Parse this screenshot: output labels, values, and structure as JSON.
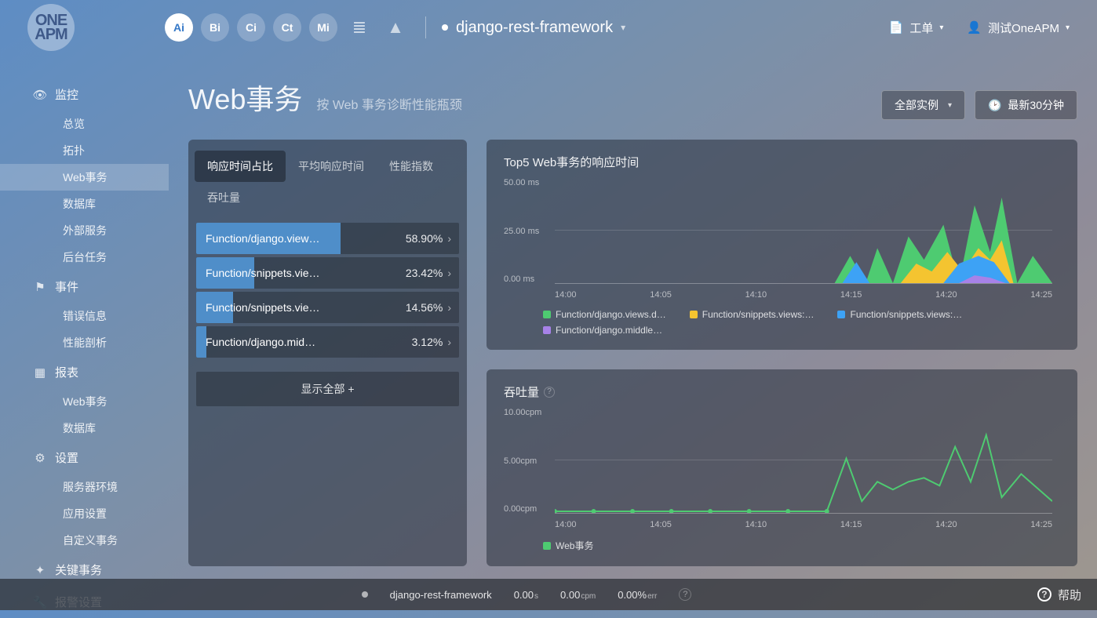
{
  "header": {
    "logo_text": "ONE\nAPM",
    "nav_badges": [
      "Ai",
      "Bi",
      "Ci",
      "Ct",
      "Mi"
    ],
    "app_name": "django-rest-framework",
    "ticket_label": "工单",
    "user_label": "测试OneAPM"
  },
  "sidebar": {
    "groups": [
      {
        "icon": "eye",
        "label": "监控",
        "items": [
          {
            "label": "总览"
          },
          {
            "label": "拓扑"
          },
          {
            "label": "Web事务",
            "active": true
          },
          {
            "label": "数据库"
          },
          {
            "label": "外部服务"
          },
          {
            "label": "后台任务"
          }
        ]
      },
      {
        "icon": "flag",
        "label": "事件",
        "items": [
          {
            "label": "错误信息"
          },
          {
            "label": "性能剖析"
          }
        ]
      },
      {
        "icon": "table",
        "label": "报表",
        "items": [
          {
            "label": "Web事务"
          },
          {
            "label": "数据库"
          }
        ]
      },
      {
        "icon": "gear",
        "label": "设置",
        "items": [
          {
            "label": "服务器环境"
          },
          {
            "label": "应用设置"
          },
          {
            "label": "自定义事务"
          }
        ]
      },
      {
        "icon": "star",
        "label": "关键事务",
        "items": []
      },
      {
        "icon": "wrench",
        "label": "报警设置",
        "dim": true,
        "items": []
      }
    ]
  },
  "page": {
    "title": "Web事务",
    "subtitle": "按 Web 事务诊断性能瓶颈",
    "instances_label": "全部实例",
    "timerange_label": "最新30分钟"
  },
  "left_panel": {
    "tabs": [
      "响应时间占比",
      "平均响应时间",
      "性能指数",
      "吞吐量"
    ],
    "active_tab": 0,
    "rows": [
      {
        "name": "Function/django.view…",
        "pct": "58.90%",
        "bar": 55
      },
      {
        "name": "Function/snippets.vie…",
        "pct": "23.42%",
        "bar": 22
      },
      {
        "name": "Function/snippets.vie…",
        "pct": "14.56%",
        "bar": 14
      },
      {
        "name": "Function/django.mid…",
        "pct": "3.12%",
        "bar": 4
      }
    ],
    "show_all": "显示全部 +"
  },
  "chart1": {
    "title": "Top5 Web事务的响应时间",
    "yticks": [
      "50.00 ms",
      "25.00 ms",
      "0.00 ms"
    ],
    "xticks": [
      "14:00",
      "14:05",
      "14:10",
      "14:15",
      "14:20",
      "14:25"
    ],
    "legend": [
      {
        "color": "#4ecb71",
        "label": "Function/django.views.d…"
      },
      {
        "color": "#f4c430",
        "label": "Function/snippets.views:…"
      },
      {
        "color": "#3da2f5",
        "label": "Function/snippets.views:…"
      },
      {
        "color": "#a782e8",
        "label": "Function/django.middle…"
      }
    ]
  },
  "chart2": {
    "title": "吞吐量",
    "yticks": [
      "10.00cpm",
      "5.00cpm",
      "0.00cpm"
    ],
    "xticks": [
      "14:00",
      "14:05",
      "14:10",
      "14:15",
      "14:20",
      "14:25"
    ],
    "legend": [
      {
        "color": "#4ecb71",
        "label": "Web事务"
      }
    ]
  },
  "chart_data": [
    {
      "type": "area",
      "title": "Top5 Web事务的响应时间",
      "xlabel": "",
      "ylabel": "ms",
      "ylim": [
        0,
        50
      ],
      "x": [
        "14:00",
        "14:05",
        "14:10",
        "14:15",
        "14:20",
        "14:25"
      ],
      "series": [
        {
          "name": "Function/django.views.d…",
          "color": "#4ecb71",
          "values": [
            0,
            0,
            0,
            20,
            33,
            0
          ]
        },
        {
          "name": "Function/snippets.views:…",
          "color": "#f4c430",
          "values": [
            0,
            0,
            0,
            10,
            18,
            0
          ]
        },
        {
          "name": "Function/snippets.views:…",
          "color": "#3da2f5",
          "values": [
            0,
            0,
            0,
            8,
            15,
            0
          ]
        },
        {
          "name": "Function/django.middle…",
          "color": "#a782e8",
          "values": [
            0,
            0,
            0,
            2,
            3,
            0
          ]
        }
      ]
    },
    {
      "type": "line",
      "title": "吞吐量",
      "xlabel": "",
      "ylabel": "cpm",
      "ylim": [
        0,
        10
      ],
      "x": [
        "14:00",
        "14:05",
        "14:10",
        "14:15",
        "14:20",
        "14:25"
      ],
      "series": [
        {
          "name": "Web事务",
          "color": "#4ecb71",
          "values": [
            0,
            0,
            0,
            3,
            6,
            2
          ]
        }
      ]
    }
  ],
  "footer": {
    "app": "django-rest-framework",
    "stats": [
      {
        "val": "0.00",
        "unit": "s"
      },
      {
        "val": "0.00",
        "unit": "cpm"
      },
      {
        "val": "0.00%",
        "unit": "err"
      }
    ],
    "help": "帮助"
  }
}
